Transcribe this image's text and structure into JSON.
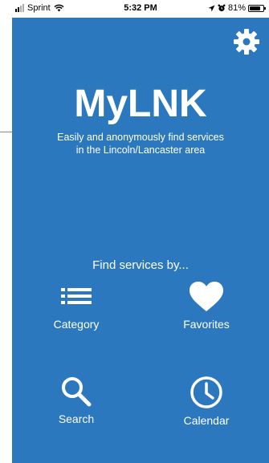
{
  "status_bar": {
    "carrier": "Sprint",
    "time": "5:32 PM",
    "battery": "81%",
    "battery_level": 0.81
  },
  "app": {
    "title": "MyLNK",
    "tagline_line1": "Easily and anonymously find services",
    "tagline_line2": "in the Lincoln/Lancaster area",
    "find_label": "Find services by...",
    "colors": {
      "background": "#2b78bf",
      "foreground": "#ffffff"
    }
  },
  "menu": {
    "category": {
      "label": "Category",
      "icon": "list-icon"
    },
    "favorites": {
      "label": "Favorites",
      "icon": "heart-icon"
    },
    "search": {
      "label": "Search",
      "icon": "search-icon"
    },
    "calendar": {
      "label": "Calendar",
      "icon": "clock-icon"
    }
  },
  "settings": {
    "icon": "gear-icon"
  }
}
